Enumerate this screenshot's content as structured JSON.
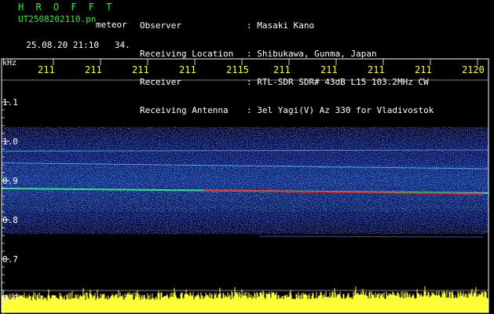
{
  "header": {
    "brand": "H R O F F T",
    "filename": "UT2508202110.pn",
    "meteor": "meteor",
    "datetime": "25.08.20 21:10",
    "frame": "34.",
    "fields": [
      {
        "label": "Observer",
        "value": ": Masaki Kano"
      },
      {
        "label": "Receiving Location",
        "value": ": Shibukawa, Gunma, Japan"
      },
      {
        "label": "Receiver",
        "value": ": RTL-SDR SDR# 43dB L15 103.2MHz CW"
      },
      {
        "label": "Receiving Antenna",
        "value": ": 3el Yagi(V) Az 330 for Vladivostok"
      }
    ]
  },
  "spectrogram": {
    "freq_unit": "kHz",
    "y_ticks": [
      "1.1",
      "1.0",
      "0.9",
      "0.8",
      "0.7",
      "0.6"
    ],
    "y_tick_values": [
      1.1,
      1.0,
      0.9,
      0.8,
      0.7,
      0.6
    ],
    "time_ticks": [
      "211",
      "211",
      "211",
      "211",
      "2115",
      "211",
      "211",
      "211",
      "211",
      "2120"
    ],
    "colors": {
      "frame": "#ffffff",
      "text_yellow": "#ffff33",
      "text_green": "#3fe63f",
      "noise": "#2040ff",
      "signal": "#ff2020",
      "trace": "#33ff88"
    }
  }
}
